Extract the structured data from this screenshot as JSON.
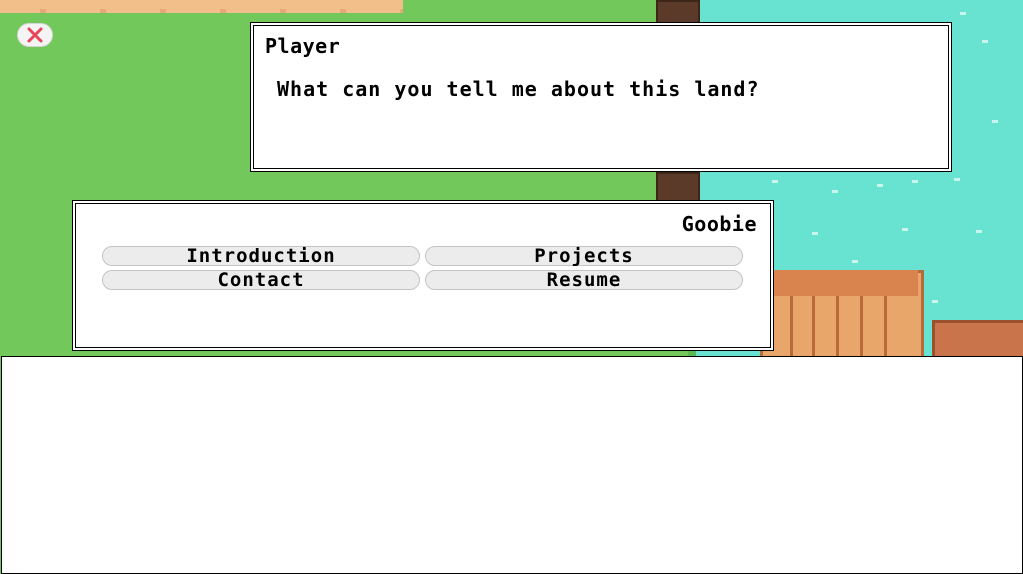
{
  "player_dialog": {
    "speaker": "Player",
    "line": "What can you tell me about this land?"
  },
  "npc_dialog": {
    "speaker": "Goobie",
    "options": [
      {
        "label": "Introduction"
      },
      {
        "label": "Projects"
      },
      {
        "label": "Contact"
      },
      {
        "label": "Resume"
      }
    ]
  },
  "close_button": {
    "icon": "close-icon",
    "color": "#e8455a"
  },
  "colors": {
    "grass": "#72c85a",
    "water": "#68e3d2",
    "sand": "#f2bf8a"
  }
}
